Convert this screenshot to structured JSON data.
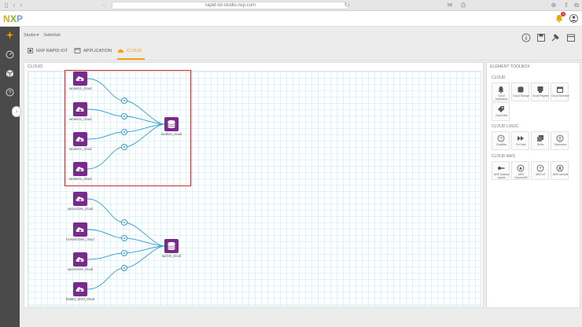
{
  "browser": {
    "url": "rapid-iot-studio.nxp.com"
  },
  "header": {
    "logo": "NXP",
    "notification_count": "1"
  },
  "breadcrumb": [
    "Studio",
    "SafeHub"
  ],
  "tabs": [
    {
      "label": "NXP RAPID IOT",
      "icon": "chip-icon"
    },
    {
      "label": "APPLICATION",
      "icon": "window-icon"
    },
    {
      "label": "CLOUD",
      "icon": "cloud-icon"
    }
  ],
  "canvas": {
    "title": "CLOUD",
    "group_a_nodes": [
      "random1_cloud",
      "random1_cloud",
      "random1_cloud",
      "random1_cloud"
    ],
    "group_a_target": "random_cloud",
    "group_b_nodes": [
      "open/close_cloud",
      "locked/close_cloud",
      "open/close_cloud",
      "battery_level_cloud"
    ],
    "group_b_target": "sprinkl_cloud"
  },
  "toolbox": {
    "title": "ELEMENT TOOLBOX",
    "sections": [
      {
        "title": "CLOUD",
        "items": [
          "Cloud Notification",
          "Cloud Storage",
          "Cloud Register",
          "Cloud Schedule",
          "Cloud Alert"
        ]
      },
      {
        "title": "CLOUD LOGIC",
        "items": [
          "Condition",
          "For Each",
          "Buffer",
          "Expression"
        ]
      },
      {
        "title": "CLOUD AWS",
        "items": [
          "AWS Shadow Update",
          "AWS DynamoDB",
          "AWS IoT",
          "AWS Lambda"
        ]
      }
    ]
  },
  "colors": {
    "node": "#7a2a8a",
    "wire": "#2a9fd6",
    "accent": "#f5a100",
    "highlight": "#d9302f"
  }
}
